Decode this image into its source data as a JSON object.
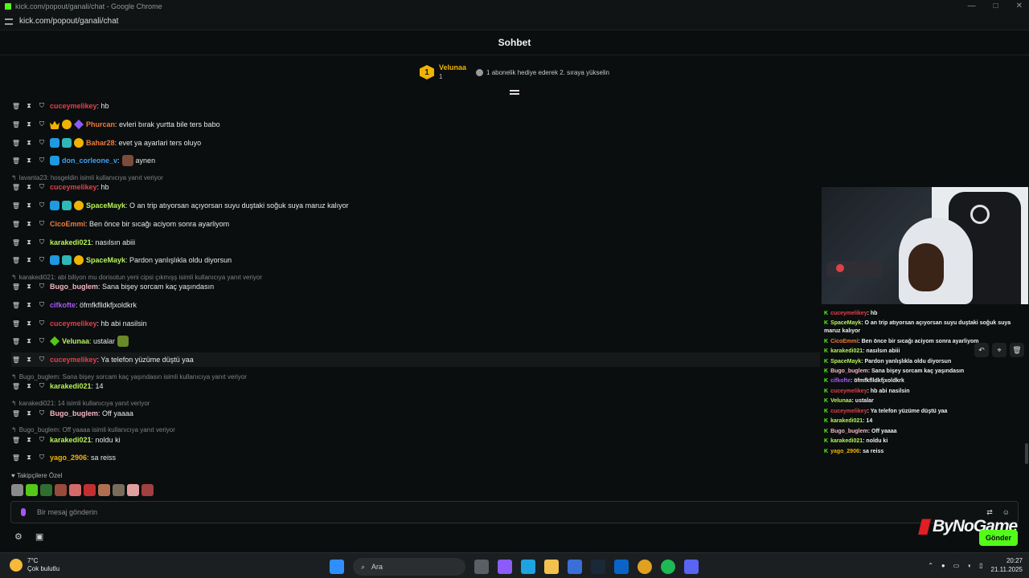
{
  "window": {
    "title": "kick.com/popout/ganali/chat - Google Chrome",
    "url": "kick.com/popout/ganali/chat"
  },
  "chat": {
    "title": "Sohbet"
  },
  "pinned": {
    "rank": "1",
    "user": "Velunaa",
    "count": "1",
    "gift_text": "1 abonelik hediye ederek 2. sıraya yükselin"
  },
  "messages": [
    {
      "user": "cuceymelikey",
      "color": "#e0404a",
      "text": ": hb"
    },
    {
      "user": "Phurcan",
      "color": "#f07a3b",
      "text": ": evleri bırak yurtta bile ters babo"
    },
    {
      "user": "Bahar28",
      "color": "#f07a3b",
      "text": ": evet ya ayarlari ters oluyo"
    },
    {
      "user": "don_corleone_v",
      "color": "#3fa0f0",
      "text": ":",
      "after": "aynen"
    },
    {
      "reply": "lavanta23: hosgeldin isimli kullanıcıya yanıt veriyor"
    },
    {
      "user": "cuceymelikey",
      "color": "#e0404a",
      "text": ": hb"
    },
    {
      "user": "SpaceMayk",
      "color": "#b6f25a",
      "text": ": O an trip atıyorsan açıyorsan suyu duştaki soğuk suya maruz kalıyor"
    },
    {
      "user": "CicoEmmi",
      "color": "#f07a3b",
      "text": ": Ben önce bir sıcağı aciyom sonra ayarliyom"
    },
    {
      "user": "karakedi021",
      "color": "#b6f25a",
      "text": ": nasılsın abiii"
    },
    {
      "user": "SpaceMayk",
      "color": "#b6f25a",
      "text": ": Pardon yanlışlıkla oldu diyorsun"
    },
    {
      "reply": "karakedi021: abi biliyon mu dorisotun yeni cipsi çıkmışş isimli kullanıcıya yanıt veriyor"
    },
    {
      "user": "Bugo_buglem",
      "color": "#f4b6c2",
      "text": ": Sana bişey sorcam kaç yaşındasın"
    },
    {
      "user": "cifkofte",
      "color": "#a855f7",
      "text": ": öfmfkflldkfjxoldkrk"
    },
    {
      "user": "cuceymelikey",
      "color": "#e0404a",
      "text": ": hb abi nasilsin"
    },
    {
      "user": "Velunaa",
      "color": "#b6f25a",
      "text": ": ustalar"
    },
    {
      "user": "cuceymelikey",
      "color": "#e0404a",
      "text": ": Ya telefon yüzüme düştü yaa"
    },
    {
      "reply": "Bugo_buglem: Sana bişey sorcam kaç yaşındasın isimli kullanıcıya yanıt veriyor"
    },
    {
      "user": "karakedi021",
      "color": "#b6f25a",
      "text": ": 14"
    },
    {
      "reply": "karakedi021: 14 isimli kullanıcıya yanıt veriyor"
    },
    {
      "user": "Bugo_buglem",
      "color": "#f4b6c2",
      "text": ": Off yaaaa"
    },
    {
      "reply": "Bugo_buglem: Off yaaaa isimli kullanıcıya yanıt veriyor"
    },
    {
      "user": "karakedi021",
      "color": "#b6f25a",
      "text": ": noldu ki"
    },
    {
      "user": "yago_2906",
      "color": "#f0b400",
      "text": ": sa reiss"
    }
  ],
  "followers_label": "Takipçilere Özel",
  "input": {
    "placeholder": "Bir mesaj gönderin"
  },
  "send_label": "Gönder",
  "watermark": "ByNoGame",
  "overlay": [
    {
      "user": "cuceymelikey",
      "color": "#e0404a",
      "text": ": hb"
    },
    {
      "user": "SpaceMayk",
      "color": "#b6f25a",
      "text": ": O an trip atıyorsan açıyorsan suyu duştaki soğuk suya"
    },
    {
      "user": "",
      "color": "#f0f0f0",
      "text": "maruz kalıyor"
    },
    {
      "user": "CicoEmmi",
      "color": "#f07a3b",
      "text": ": Ben önce bir sıcağı aciyom sonra ayarliyom"
    },
    {
      "user": "karakedi021",
      "color": "#b6f25a",
      "text": ": nasılsın abiii"
    },
    {
      "user": "SpaceMayk",
      "color": "#b6f25a",
      "text": ": Pardon yanlışlıkla oldu diyorsun"
    },
    {
      "user": "Bugo_buglem",
      "color": "#f4b6c2",
      "text": ": Sana bişey sorcam kaç yaşındasın"
    },
    {
      "user": "cifkofte",
      "color": "#a855f7",
      "text": ": öfmfkflldkfjxoldkrk"
    },
    {
      "user": "cuceymelikey",
      "color": "#e0404a",
      "text": ": hb abi nasilsin"
    },
    {
      "user": "Velunaa",
      "color": "#b6f25a",
      "text": ": ustalar"
    },
    {
      "user": "cuceymelikey",
      "color": "#e0404a",
      "text": ": Ya telefon yüzüme düştü yaa"
    },
    {
      "user": "karakedi021",
      "color": "#b6f25a",
      "text": ": 14"
    },
    {
      "user": "Bugo_buglem",
      "color": "#f4b6c2",
      "text": ": Off yaaaa"
    },
    {
      "user": "karakedi021",
      "color": "#b6f25a",
      "text": ": noldu ki"
    },
    {
      "user": "yago_2906",
      "color": "#f0b400",
      "text": ": sa reiss"
    }
  ],
  "taskbar": {
    "temp": "7°C",
    "weather": "Çok bulutlu",
    "search": "Ara",
    "time": "20:27",
    "date": "21.11.2025"
  }
}
